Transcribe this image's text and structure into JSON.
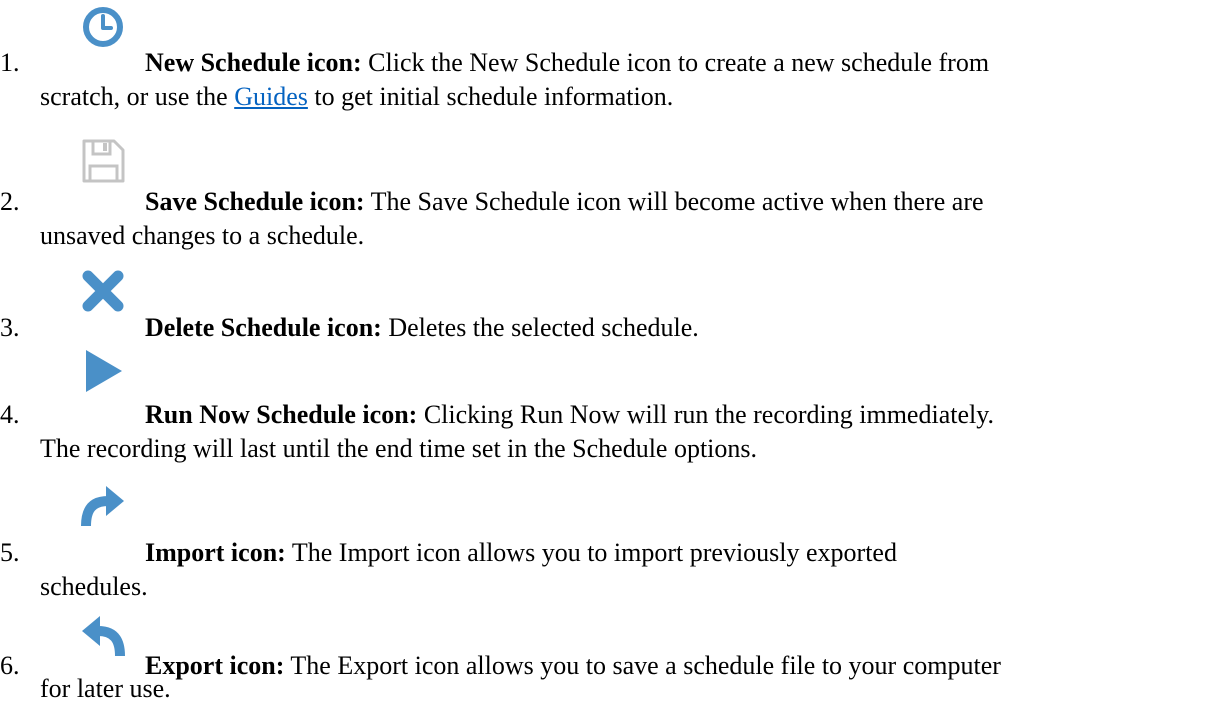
{
  "colors": {
    "icon_blue": "#4a90c8",
    "icon_gray": "#c4c4c4",
    "link": "#0563c1"
  },
  "items": [
    {
      "number": "1.",
      "icon": "clock-icon",
      "label": "New Schedule icon:",
      "line1": " Click the New Schedule icon to create a new schedule from",
      "line2_before": "scratch, or use the ",
      "link_text": "Guides",
      "line2_after": " to get initial schedule information."
    },
    {
      "number": "2.",
      "icon": "save-floppy-icon",
      "label": "Save Schedule icon:",
      "line1": " The Save Schedule icon will become active when there are",
      "line2": "unsaved changes to a schedule."
    },
    {
      "number": "3.",
      "icon": "delete-x-icon",
      "label": "Delete Schedule icon:",
      "line1": " Deletes the selected schedule."
    },
    {
      "number": "4.",
      "icon": "play-icon",
      "label": "Run Now Schedule icon:",
      "line1": " Clicking Run Now will run the recording immediately.",
      "line2": "The recording will last until the end time set in the Schedule options."
    },
    {
      "number": "5.",
      "icon": "import-arrow-icon",
      "label": "Import icon:",
      "line1": " The Import icon allows you to import previously exported",
      "line2": "schedules."
    },
    {
      "number": "6.",
      "icon": "export-arrow-icon",
      "label": "Export icon:",
      "line1": " The Export icon allows you to save a schedule file to your computer",
      "line2": "for later use."
    }
  ]
}
